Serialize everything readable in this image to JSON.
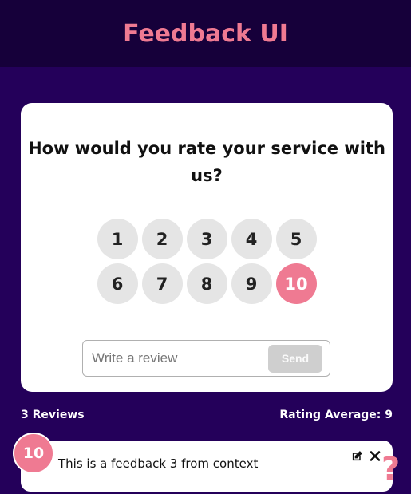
{
  "header": {
    "title": "Feedback UI"
  },
  "form": {
    "question": "How would you rate your service with us?",
    "ratings": [
      "1",
      "2",
      "3",
      "4",
      "5",
      "6",
      "7",
      "8",
      "9",
      "10"
    ],
    "selected_rating": 10,
    "review_placeholder": "Write a review",
    "review_value": "",
    "send_label": "Send"
  },
  "stats": {
    "reviews_label": "3 Reviews",
    "average_label": "Rating Average: 9"
  },
  "feedback_items": [
    {
      "rating": "10",
      "text": "This is a feedback 3 from context"
    }
  ],
  "icons": {
    "edit": "edit-icon",
    "close": "close-icon",
    "help": "question-mark-icon"
  },
  "colors": {
    "accent": "#ef7a92",
    "background": "#24005a",
    "header": "#16003a"
  }
}
